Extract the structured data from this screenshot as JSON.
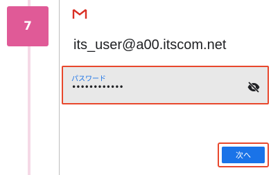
{
  "step": {
    "number": "7"
  },
  "app": {
    "logo_icon": "gmail-icon"
  },
  "account": {
    "email": "its_user@a00.itscom.net"
  },
  "password": {
    "label": "パスワード",
    "value": "••••••••••••",
    "toggle_icon": "eye-off-icon"
  },
  "actions": {
    "next_label": "次へ"
  },
  "colors": {
    "step_badge": "#e05a97",
    "step_rail": "#f5d9e6",
    "highlight": "#e8472c",
    "primary": "#1a73e8",
    "gmail_red": "#d93025"
  }
}
